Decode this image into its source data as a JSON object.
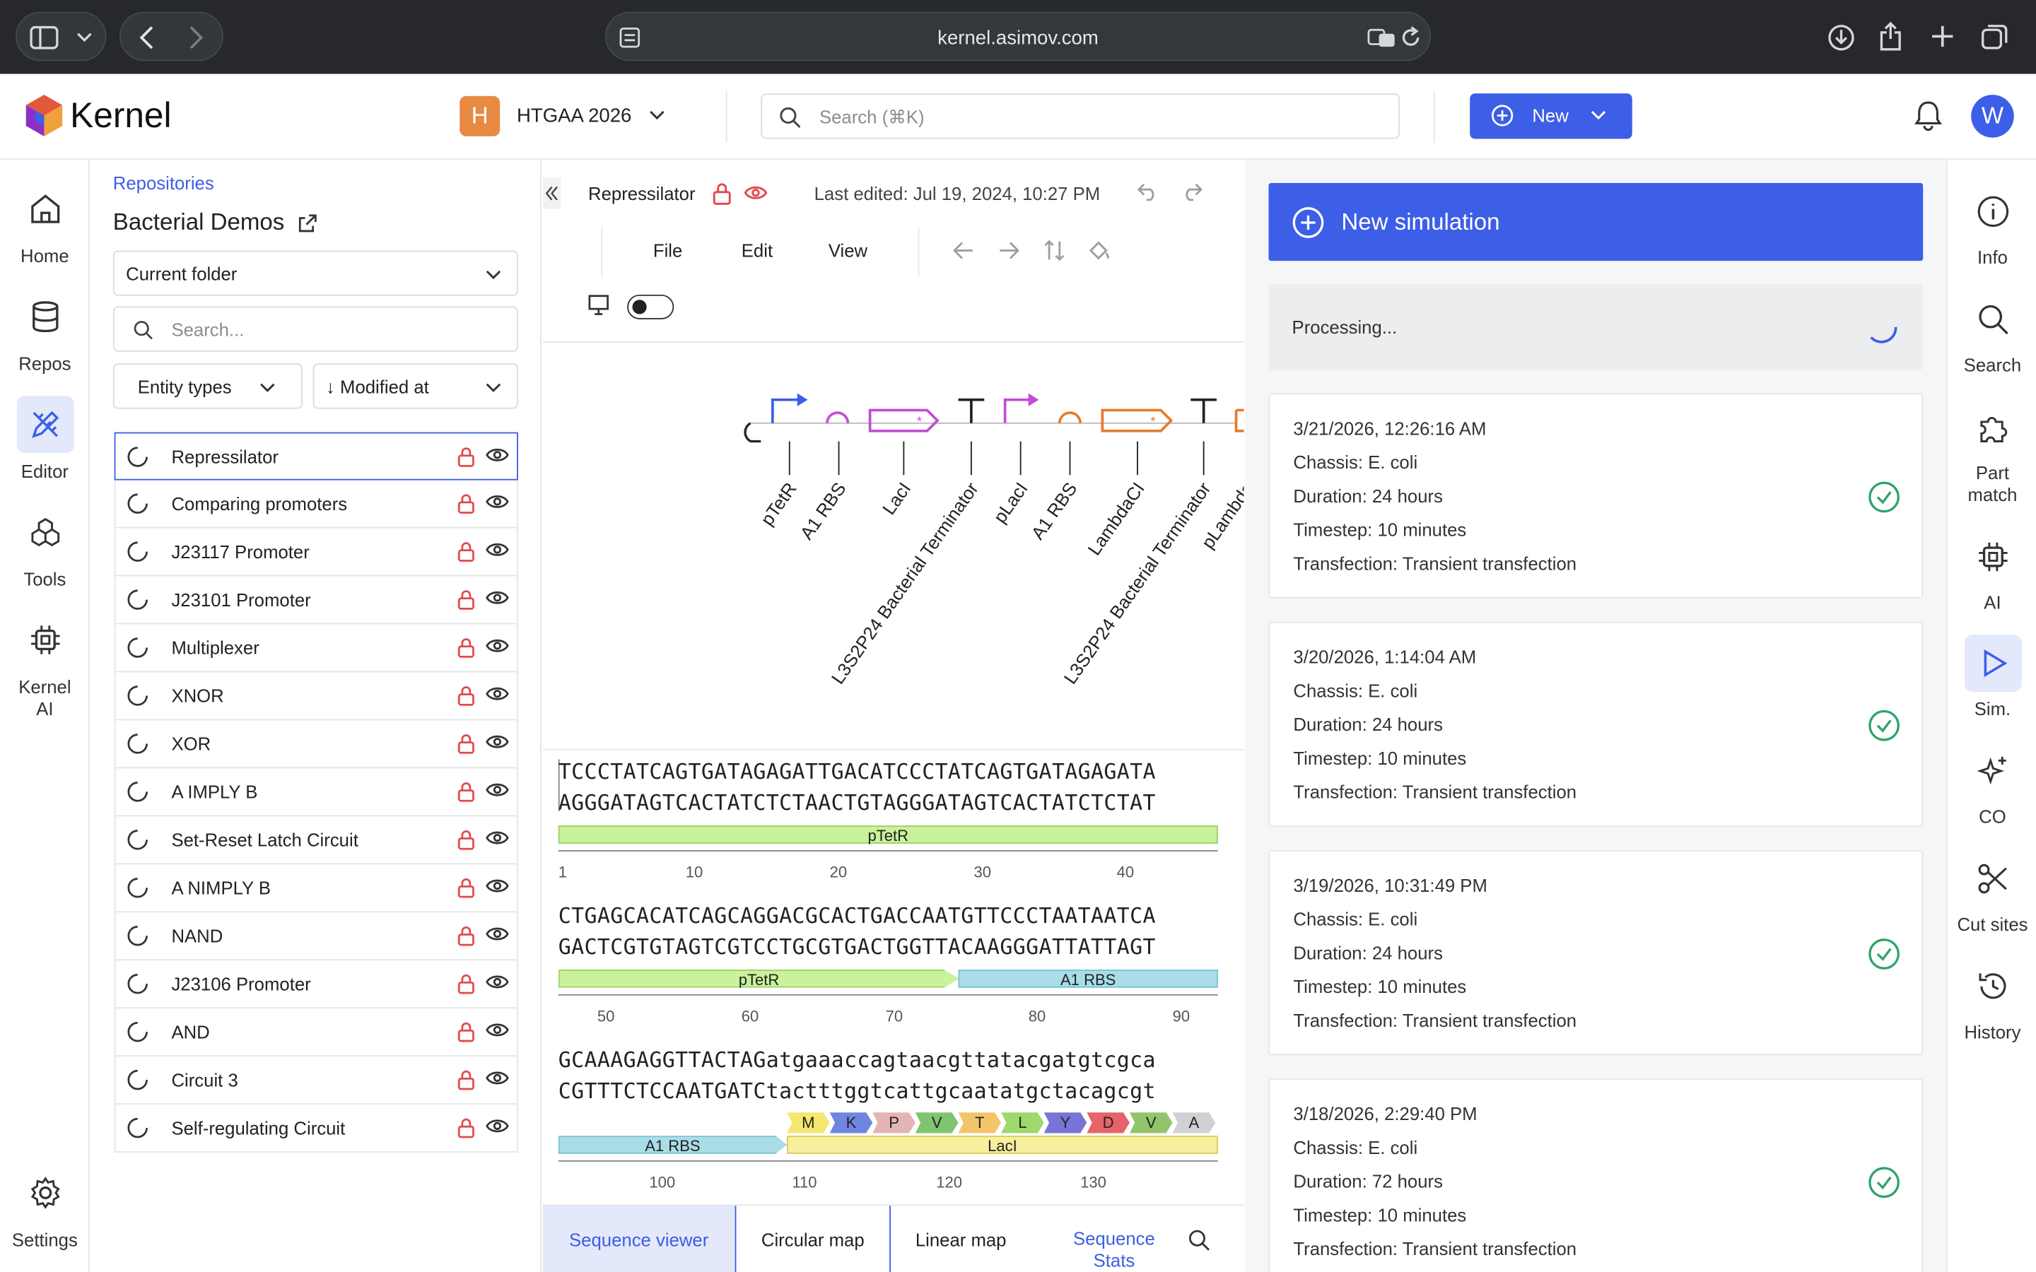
{
  "browser": {
    "url": "kernel.asimov.com"
  },
  "app": {
    "name": "Kernel",
    "workspace_initial": "H",
    "workspace": "HTGAA 2026",
    "search_placeholder": "Search (⌘K)",
    "new_label": "New",
    "user_initial": "W"
  },
  "left_rail": [
    {
      "label": "Home",
      "icon": "home-icon"
    },
    {
      "label": "Repos",
      "icon": "database-icon"
    },
    {
      "label": "Editor",
      "icon": "pencil-ruler-icon",
      "active": true
    },
    {
      "label": "Tools",
      "icon": "tools-icon"
    },
    {
      "label": "Kernel AI",
      "icon": "chip-icon"
    },
    {
      "label": "Settings",
      "icon": "gear-icon"
    }
  ],
  "file_panel": {
    "breadcrumb": "Repositories",
    "title": "Bacterial Demos",
    "folder_select": "Current folder",
    "search_placeholder": "Search...",
    "filter_entity": "Entity types",
    "sort": "↓ Modified at",
    "entities": [
      "Repressilator",
      "Comparing promoters",
      "J23117 Promoter",
      "J23101 Promoter",
      "Multiplexer",
      "XNOR",
      "XOR",
      "A IMPLY B",
      "Set-Reset Latch Circuit",
      "A NIMPLY B",
      "NAND",
      "J23106 Promoter",
      "AND",
      "Circuit 3",
      "Self-regulating Circuit"
    ]
  },
  "editor": {
    "title": "Repressilator",
    "last_edited": "Last edited: Jul 19, 2024, 10:27 PM",
    "menus": [
      "File",
      "Edit",
      "View"
    ],
    "map_parts": [
      "pTetR",
      "A1 RBS",
      "LacI",
      "L3S2P24 Bacterial Terminator",
      "pLacI",
      "A1 RBS",
      "LambdaCI",
      "L3S2P24 Bacterial Terminator",
      "pLambda"
    ],
    "blocks": [
      {
        "top": "TCCCTATCAGTGATAGAGATTGACATCCCTATCAGTGATAGAGATA",
        "bottom": "AGGGATAGTCACTATCTCTAACTGTAGGGATAGTCACTATCTCTAT",
        "features": [
          "pTetR"
        ],
        "ticks": [
          "1",
          "10",
          "20",
          "30",
          "40"
        ]
      },
      {
        "top": "CTGAGCACATCAGCAGGACGCACTGACCAATGTTCCCTAATAATCA",
        "bottom": "GACTCGTGTAGTCGTCCTGCGTGACTGGTTACAAGGGATTATTAGT",
        "features": [
          "pTetR",
          "A1 RBS"
        ],
        "ticks": [
          "50",
          "60",
          "70",
          "80",
          "90"
        ]
      },
      {
        "top": "GCAAAGAGGTTACTAGatgaaaccagtaacgttatacgatgtcgca",
        "bottom": "CGTTTCTCCAATGATCtactttggtcattgcaatatgctacagcgt",
        "features": [
          "A1 RBS",
          "LacI"
        ],
        "translation": [
          "M",
          "K",
          "P",
          "V",
          "T",
          "L",
          "Y",
          "D",
          "V",
          "A"
        ],
        "ticks": [
          "100",
          "110",
          "120",
          "130"
        ]
      }
    ],
    "tabs": [
      "Sequence viewer",
      "Circular map",
      "Linear map",
      "Sequence Stats"
    ],
    "active_tab": "Sequence viewer"
  },
  "sim_panel": {
    "new_simulation": "New simulation",
    "processing": "Processing...",
    "runs": [
      {
        "date": "3/21/2026, 12:26:16 AM",
        "chassis": "Chassis: E. coli",
        "duration": "Duration: 24 hours",
        "timestep": "Timestep: 10 minutes",
        "transfection": "Transfection: Transient transfection"
      },
      {
        "date": "3/20/2026, 1:14:04 AM",
        "chassis": "Chassis: E. coli",
        "duration": "Duration: 24 hours",
        "timestep": "Timestep: 10 minutes",
        "transfection": "Transfection: Transient transfection"
      },
      {
        "date": "3/19/2026, 10:31:49 PM",
        "chassis": "Chassis: E. coli",
        "duration": "Duration: 24 hours",
        "timestep": "Timestep: 10 minutes",
        "transfection": "Transfection: Transient transfection"
      },
      {
        "date": "3/18/2026, 2:29:40 PM",
        "chassis": "Chassis: E. coli",
        "duration": "Duration: 72 hours",
        "timestep": "Timestep: 10 minutes",
        "transfection": "Transfection: Transient transfection"
      }
    ]
  },
  "right_rail": [
    {
      "label": "Info",
      "icon": "info-icon"
    },
    {
      "label": "Search",
      "icon": "search-icon"
    },
    {
      "label": "Part match",
      "icon": "puzzle-icon"
    },
    {
      "label": "AI",
      "icon": "chip-icon"
    },
    {
      "label": "Sim.",
      "icon": "play-icon",
      "active": true
    },
    {
      "label": "CO",
      "icon": "sparkle-icon"
    },
    {
      "label": "Cut sites",
      "icon": "scissors-icon"
    },
    {
      "label": "History",
      "icon": "history-icon"
    }
  ],
  "colors": {
    "accent": "#3d5ee6",
    "promoter_feature": "#c9f29b",
    "rbs_feature": "#a9dde8",
    "cds_feature": "#f7ef9e",
    "lock": "#e5484d",
    "ok": "#2ea36a"
  }
}
